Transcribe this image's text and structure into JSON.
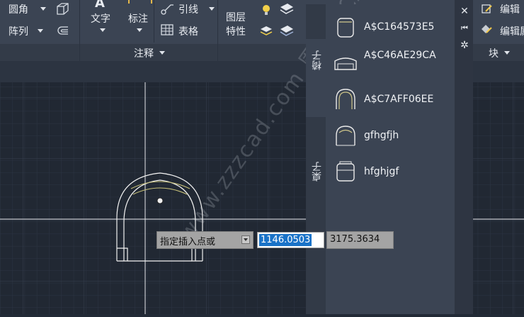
{
  "ribbon": {
    "modify": {
      "fillet_label": "圆角",
      "array_label": "阵列"
    },
    "annotation": {
      "text_label": "文字",
      "dimension_label": "标注",
      "leader_label": "引线",
      "table_label": "表格",
      "panel_title": "注释"
    },
    "layers": {
      "layer_props_label_1": "图层",
      "layer_props_label_2": "特性"
    },
    "block": {
      "edit_label": "编辑",
      "edit_attr_label": "编辑属",
      "panel_title": "块"
    }
  },
  "palette": {
    "tabs": [
      {
        "label": "椅子"
      },
      {
        "label": "桌子"
      }
    ],
    "items": [
      {
        "name": "A$C164573E5"
      },
      {
        "name": "A$C46AE29CA"
      },
      {
        "name": "A$C7AFF06EE"
      },
      {
        "name": "gfhgfjh"
      },
      {
        "name": "hfghjgf"
      }
    ],
    "buttons": {
      "close": "✕",
      "autohide": "⏮",
      "properties": "✲"
    }
  },
  "dynamic_input": {
    "prompt": "指定插入点或",
    "x_value": "1146.0503",
    "y_value": "3175.3634"
  },
  "watermark": "www.zzzcad.com 周站长CAD",
  "colors": {
    "canvas": "#212833",
    "ribbon": "#3b4453",
    "selection": "#1a73c8"
  }
}
